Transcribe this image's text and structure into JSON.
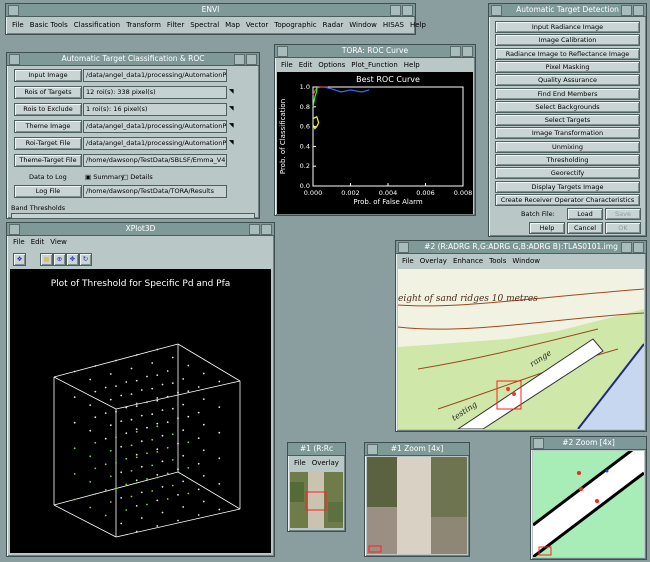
{
  "envi": {
    "title": "ENVI",
    "menu": [
      "File",
      "Basic Tools",
      "Classification",
      "Transform",
      "Filter",
      "Spectral",
      "Map",
      "Vector",
      "Topographic",
      "Radar",
      "Window",
      "HISAS",
      "Help"
    ]
  },
  "atc": {
    "title": "Automatic Target Classification & ROC",
    "rows": [
      {
        "button": "Input Image",
        "value": "/data/angel_data1/processing/AutomationP",
        "arrow": false
      },
      {
        "button": "Rois of Targets",
        "value": "12 roi(s): 338 pixel(s)",
        "arrow": true
      },
      {
        "button": "Rois to Exclude",
        "value": "1 roi(s): 16 pixel(s)",
        "arrow": true
      },
      {
        "button": "Theme Image",
        "value": "/data/angel_data1/processing/AutomationP",
        "arrow": true
      },
      {
        "button": "Roi-Target File",
        "value": "/data/angel_data1/processing/AutomationP",
        "arrow": true
      },
      {
        "button": "Theme-Target File",
        "value": "/home/dawsonp/TestData/SBLSF/Emma_V4_8_8",
        "arrow": false
      }
    ],
    "data_to_log_label": "Data to Log",
    "summary_label": "Summary",
    "details_label": "Details",
    "log_button": "Log File",
    "log_value": "/home/dawsonp/TestData/TORA/Results",
    "band_thresholds_label": "Band Thresholds"
  },
  "tora": {
    "title": "TORA: ROC Curve",
    "menu": [
      "File",
      "Edit",
      "Options",
      "Plot_Function",
      "Help"
    ],
    "plot_title": "Best ROC Curve"
  },
  "chart_data": {
    "type": "line",
    "title": "Best ROC Curve",
    "xlabel": "Prob. of False Alarm",
    "ylabel": "Prob. of Classification",
    "xlim": [
      0,
      0.008
    ],
    "ylim": [
      0,
      1.0
    ],
    "x_ticks": [
      "0.000",
      "0.002",
      "0.004",
      "0.006",
      "0.008"
    ],
    "y_ticks": [
      "0.0",
      "0.2",
      "0.4",
      "0.6",
      "0.8",
      "1.0"
    ],
    "series": [
      {
        "color": "#ff4040",
        "x": [
          0,
          0.0001,
          0.0002,
          0.0004,
          0.0006,
          0.0008
        ],
        "y": [
          0.92,
          0.96,
          0.99,
          1.0,
          1.0,
          1.0
        ]
      },
      {
        "color": "#3a6bff",
        "x": [
          0.0006,
          0.001,
          0.0015,
          0.002,
          0.0026,
          0.003
        ],
        "y": [
          1.0,
          0.98,
          0.95,
          0.97,
          0.95,
          0.97
        ]
      },
      {
        "color": "#ffff00",
        "x": [
          0.0,
          0.0001,
          0.0002,
          0.0003,
          0.0002,
          0.0
        ],
        "y": [
          0.62,
          0.58,
          0.6,
          0.64,
          0.7,
          0.68
        ]
      },
      {
        "color": "#2cff2c",
        "x": [
          0.0,
          0.0001,
          0.0002,
          0.0002
        ],
        "y": [
          0.8,
          0.9,
          0.96,
          1.0
        ]
      }
    ]
  },
  "atd": {
    "title": "Automatic Target Detection",
    "buttons": [
      "Input Radiance Image",
      "Image Calibration",
      "Radiance Image to Reflectance Image",
      "Pixel Masking",
      "Quality Assurance",
      "Find End Members",
      "Select Backgrounds",
      "Select Targets",
      "Image Transformation",
      "Unmixing",
      "Thresholding",
      "Georectify",
      "Display Targets Image",
      "Create Receiver Operator Characteristics"
    ],
    "batch_label": "Batch File:",
    "load": "Load",
    "save": "Save",
    "help": "Help",
    "cancel": "Cancel",
    "ok": "OK"
  },
  "xplot": {
    "title": "XPlot3D",
    "menu": [
      "File",
      "Edit",
      "View"
    ],
    "plot_title": "Plot of Threshold for Specific Pd and Pfa"
  },
  "img2": {
    "title": "#2 (R:ADRG R,G:ADRG G,B:ADRG B):TLAS0101.img",
    "menu": [
      "File",
      "Overlay",
      "Enhance",
      "Tools",
      "Window"
    ],
    "map_text_1": "eight of sand ridges 10 metres",
    "map_text_2": "range",
    "map_text_3": "testing"
  },
  "img1": {
    "title": "#1 (R:Rc",
    "menu": [
      "File",
      "Overlay"
    ]
  },
  "zoom1": {
    "title": "#1 Zoom [4x]"
  },
  "zoom2": {
    "title": "#2 Zoom [4x]"
  }
}
